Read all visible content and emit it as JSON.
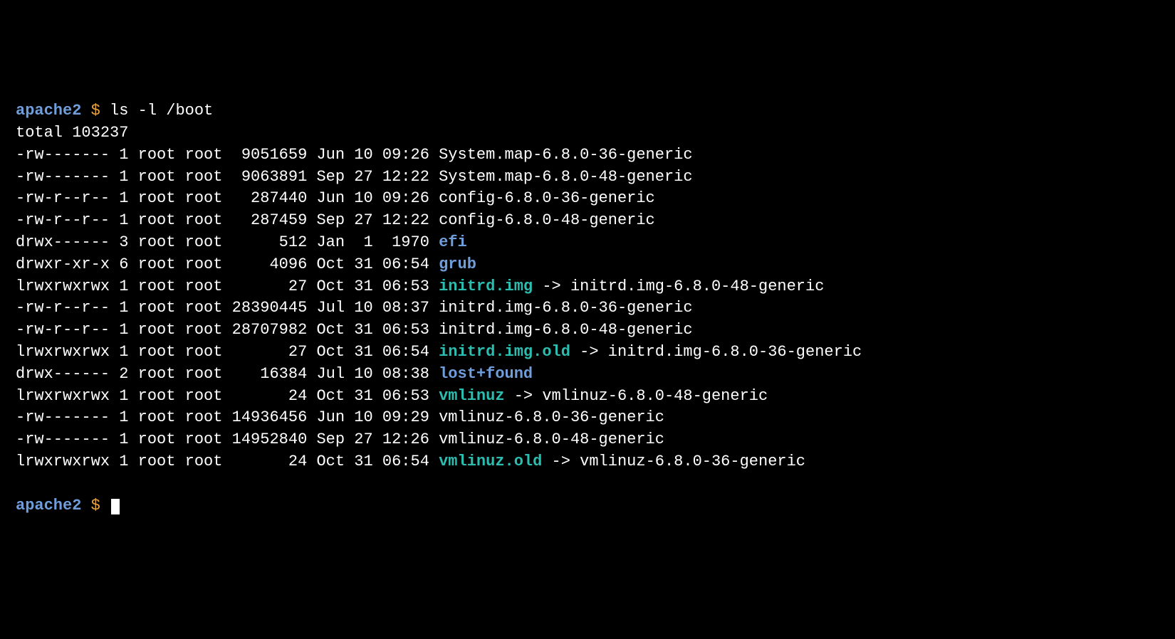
{
  "prompt_host": "apache2",
  "prompt_delim": "$",
  "command": "ls -l /boot",
  "total_line": "total 103237",
  "entries": [
    {
      "perm": "-rw-------",
      "links": "1",
      "owner": "root",
      "group": "root",
      "size": "9051659",
      "month": "Jun",
      "day": "10",
      "time": "09:26",
      "name": "System.map-6.8.0-36-generic",
      "type": "file"
    },
    {
      "perm": "-rw-------",
      "links": "1",
      "owner": "root",
      "group": "root",
      "size": "9063891",
      "month": "Sep",
      "day": "27",
      "time": "12:22",
      "name": "System.map-6.8.0-48-generic",
      "type": "file"
    },
    {
      "perm": "-rw-r--r--",
      "links": "1",
      "owner": "root",
      "group": "root",
      "size": "287440",
      "month": "Jun",
      "day": "10",
      "time": "09:26",
      "name": "config-6.8.0-36-generic",
      "type": "file"
    },
    {
      "perm": "-rw-r--r--",
      "links": "1",
      "owner": "root",
      "group": "root",
      "size": "287459",
      "month": "Sep",
      "day": "27",
      "time": "12:22",
      "name": "config-6.8.0-48-generic",
      "type": "file"
    },
    {
      "perm": "drwx------",
      "links": "3",
      "owner": "root",
      "group": "root",
      "size": "512",
      "month": "Jan",
      "day": "1",
      "time": "1970",
      "name": "efi",
      "type": "dir"
    },
    {
      "perm": "drwxr-xr-x",
      "links": "6",
      "owner": "root",
      "group": "root",
      "size": "4096",
      "month": "Oct",
      "day": "31",
      "time": "06:54",
      "name": "grub",
      "type": "dir"
    },
    {
      "perm": "lrwxrwxrwx",
      "links": "1",
      "owner": "root",
      "group": "root",
      "size": "27",
      "month": "Oct",
      "day": "31",
      "time": "06:53",
      "name": "initrd.img",
      "type": "link",
      "target": "initrd.img-6.8.0-48-generic"
    },
    {
      "perm": "-rw-r--r--",
      "links": "1",
      "owner": "root",
      "group": "root",
      "size": "28390445",
      "month": "Jul",
      "day": "10",
      "time": "08:37",
      "name": "initrd.img-6.8.0-36-generic",
      "type": "file"
    },
    {
      "perm": "-rw-r--r--",
      "links": "1",
      "owner": "root",
      "group": "root",
      "size": "28707982",
      "month": "Oct",
      "day": "31",
      "time": "06:53",
      "name": "initrd.img-6.8.0-48-generic",
      "type": "file"
    },
    {
      "perm": "lrwxrwxrwx",
      "links": "1",
      "owner": "root",
      "group": "root",
      "size": "27",
      "month": "Oct",
      "day": "31",
      "time": "06:54",
      "name": "initrd.img.old",
      "type": "link",
      "target": "initrd.img-6.8.0-36-generic"
    },
    {
      "perm": "drwx------",
      "links": "2",
      "owner": "root",
      "group": "root",
      "size": "16384",
      "month": "Jul",
      "day": "10",
      "time": "08:38",
      "name": "lost+found",
      "type": "dir"
    },
    {
      "perm": "lrwxrwxrwx",
      "links": "1",
      "owner": "root",
      "group": "root",
      "size": "24",
      "month": "Oct",
      "day": "31",
      "time": "06:53",
      "name": "vmlinuz",
      "type": "link",
      "target": "vmlinuz-6.8.0-48-generic"
    },
    {
      "perm": "-rw-------",
      "links": "1",
      "owner": "root",
      "group": "root",
      "size": "14936456",
      "month": "Jun",
      "day": "10",
      "time": "09:29",
      "name": "vmlinuz-6.8.0-36-generic",
      "type": "file"
    },
    {
      "perm": "-rw-------",
      "links": "1",
      "owner": "root",
      "group": "root",
      "size": "14952840",
      "month": "Sep",
      "day": "27",
      "time": "12:26",
      "name": "vmlinuz-6.8.0-48-generic",
      "type": "file"
    },
    {
      "perm": "lrwxrwxrwx",
      "links": "1",
      "owner": "root",
      "group": "root",
      "size": "24",
      "month": "Oct",
      "day": "31",
      "time": "06:54",
      "name": "vmlinuz.old",
      "type": "link",
      "target": "vmlinuz-6.8.0-36-generic"
    }
  ]
}
